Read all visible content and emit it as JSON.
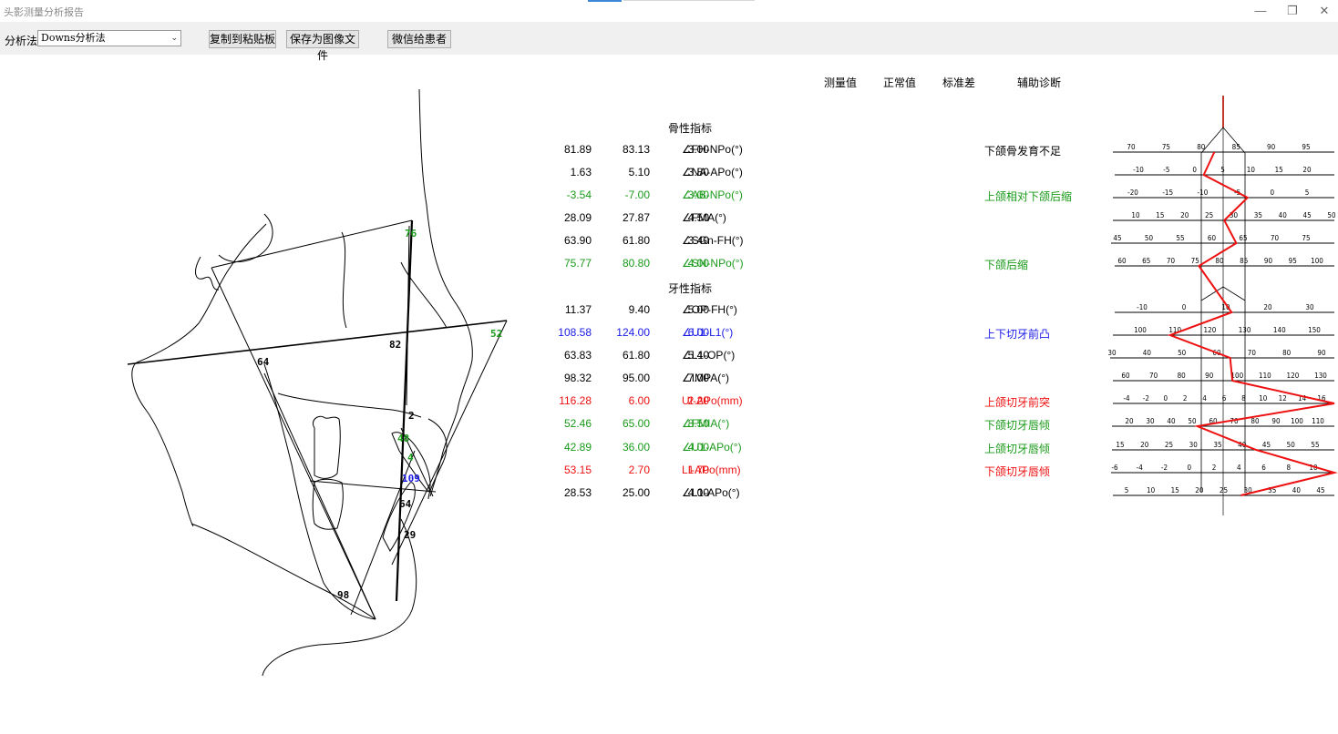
{
  "window": {
    "title": "头影测量分析报告",
    "controls": [
      {
        "name": "minimize-button",
        "glyph": "—"
      },
      {
        "name": "maximize-button",
        "glyph": "❐"
      },
      {
        "name": "close-button",
        "glyph": "✕"
      }
    ]
  },
  "toolbar": {
    "method_label": "分析法",
    "method_value": "Downs分析法",
    "copy_button": "复制到粘贴板",
    "save_button": "保存为图像文件",
    "wechat_button": "微信给患者"
  },
  "colors": {
    "black": "#000000",
    "green": "#1a9a1a",
    "blue": "#1a1ae6",
    "red": "#ee1111",
    "chart_line": "#ee1111"
  },
  "tracing": {
    "labels": [
      {
        "text": "76",
        "color": "green"
      },
      {
        "text": "52",
        "color": "green"
      },
      {
        "text": "82",
        "color": "black"
      },
      {
        "text": "64",
        "color": "black"
      },
      {
        "text": "2",
        "color": "black"
      },
      {
        "text": "48",
        "color": "green"
      },
      {
        "text": "4",
        "color": "green"
      },
      {
        "text": "109",
        "color": "blue"
      },
      {
        "text": "64",
        "color": "black"
      },
      {
        "text": "29",
        "color": "black"
      },
      {
        "text": "98",
        "color": "black"
      }
    ]
  },
  "table": {
    "headers": {
      "measured": "测量值",
      "normal": "正常值",
      "sd": "标准差",
      "diagnosis": "辅助诊断"
    },
    "sections": {
      "skeletal": "骨性指标",
      "dental": "牙性指标"
    },
    "rows": [
      {
        "name": "∠FH-NPo(°)",
        "measured": "81.89",
        "normal": "83.13",
        "sd": "3.00",
        "diagnosis": "下颌骨发育不足",
        "color": "black"
      },
      {
        "name": "∠NA-APo(°)",
        "measured": "1.63",
        "normal": "5.10",
        "sd": "3.80",
        "diagnosis": "",
        "color": "black"
      },
      {
        "name": "∠AB-NPo(°)",
        "measured": "-3.54",
        "normal": "-7.00",
        "sd": "3.00",
        "diagnosis": "上颌相对下颌后缩",
        "color": "green"
      },
      {
        "name": "∠FMA(°)",
        "measured": "28.09",
        "normal": "27.87",
        "sd": "4.50",
        "diagnosis": "",
        "color": "black"
      },
      {
        "name": "∠SGn-FH(°)",
        "measured": "63.90",
        "normal": "61.80",
        "sd": "3.40",
        "diagnosis": "",
        "color": "black"
      },
      {
        "name": "∠SN-NPo(°)",
        "measured": "75.77",
        "normal": "80.80",
        "sd": "4.00",
        "diagnosis": "下颌后缩",
        "color": "green"
      },
      {
        "name": "∠OP-FH(°)",
        "measured": "11.37",
        "normal": "9.40",
        "sd": "5.00",
        "diagnosis": "",
        "color": "black"
      },
      {
        "name": "∠U1-L1(°)",
        "measured": "108.58",
        "normal": "124.00",
        "sd": "6.00",
        "diagnosis": "上下切牙前凸",
        "color": "blue"
      },
      {
        "name": "∠L1-OP(°)",
        "measured": "63.83",
        "normal": "61.80",
        "sd": "5.40",
        "diagnosis": "",
        "color": "black"
      },
      {
        "name": "∠IMPA(°)",
        "measured": "98.32",
        "normal": "95.00",
        "sd": "7.00",
        "diagnosis": "",
        "color": "black"
      },
      {
        "name": "UI-APo(mm)",
        "measured": "116.28",
        "normal": "6.00",
        "sd": "2.20",
        "diagnosis": "上颌切牙前突",
        "color": "red"
      },
      {
        "name": "∠FMIA(°)",
        "measured": "52.46",
        "normal": "65.00",
        "sd": "8.50",
        "diagnosis": "下颌切牙唇倾",
        "color": "green"
      },
      {
        "name": "∠U1-APo(°)",
        "measured": "42.89",
        "normal": "36.00",
        "sd": "4.00",
        "diagnosis": "上颌切牙唇倾",
        "color": "green"
      },
      {
        "name": "LI-APo(mm)",
        "measured": "53.15",
        "normal": "2.70",
        "sd": "1.70",
        "diagnosis": "下颌切牙唇倾",
        "color": "red"
      },
      {
        "name": "∠L1-APo(°)",
        "measured": "28.53",
        "normal": "25.00",
        "sd": "4.00",
        "diagnosis": "",
        "color": "black"
      }
    ]
  },
  "chart_data": {
    "type": "line",
    "scales": [
      {
        "ticks": [
          "70",
          "75",
          "80",
          "85",
          "90",
          "95"
        ]
      },
      {
        "ticks": [
          "-10",
          "-5",
          "0",
          "5",
          "10",
          "15",
          "20"
        ]
      },
      {
        "ticks": [
          "-20",
          "-15",
          "-10",
          "-5",
          "0",
          "5"
        ]
      },
      {
        "ticks": [
          "10",
          "15",
          "20",
          "25",
          "30",
          "35",
          "40",
          "45",
          "50"
        ]
      },
      {
        "ticks": [
          "45",
          "50",
          "55",
          "60",
          "65",
          "70",
          "75"
        ]
      },
      {
        "ticks": [
          "60",
          "65",
          "70",
          "75",
          "80",
          "85",
          "90",
          "95",
          "100"
        ]
      },
      {
        "ticks": [
          "-10",
          "0",
          "10",
          "20",
          "30"
        ]
      },
      {
        "ticks": [
          "100",
          "110",
          "120",
          "130",
          "140",
          "150"
        ]
      },
      {
        "ticks": [
          "30",
          "40",
          "50",
          "60",
          "70",
          "80",
          "90"
        ]
      },
      {
        "ticks": [
          "60",
          "70",
          "80",
          "90",
          "100",
          "110",
          "120",
          "130"
        ]
      },
      {
        "ticks": [
          "-4",
          "-2",
          "0",
          "2",
          "4",
          "6",
          "8",
          "10",
          "12",
          "14",
          "16"
        ]
      },
      {
        "ticks": [
          "20",
          "30",
          "40",
          "50",
          "60",
          "70",
          "80",
          "90",
          "100",
          "110"
        ]
      },
      {
        "ticks": [
          "15",
          "20",
          "25",
          "30",
          "35",
          "40",
          "45",
          "50",
          "55"
        ]
      },
      {
        "ticks": [
          "-6",
          "-4",
          "-2",
          "0",
          "2",
          "4",
          "6",
          "8",
          "10"
        ]
      },
      {
        "ticks": [
          "5",
          "10",
          "15",
          "20",
          "25",
          "30",
          "35",
          "40",
          "45"
        ]
      }
    ],
    "values": [
      81.89,
      1.63,
      -3.54,
      28.09,
      63.9,
      75.77,
      11.37,
      108.58,
      63.83,
      98.32,
      116.28,
      52.46,
      42.89,
      53.15,
      28.53
    ]
  }
}
